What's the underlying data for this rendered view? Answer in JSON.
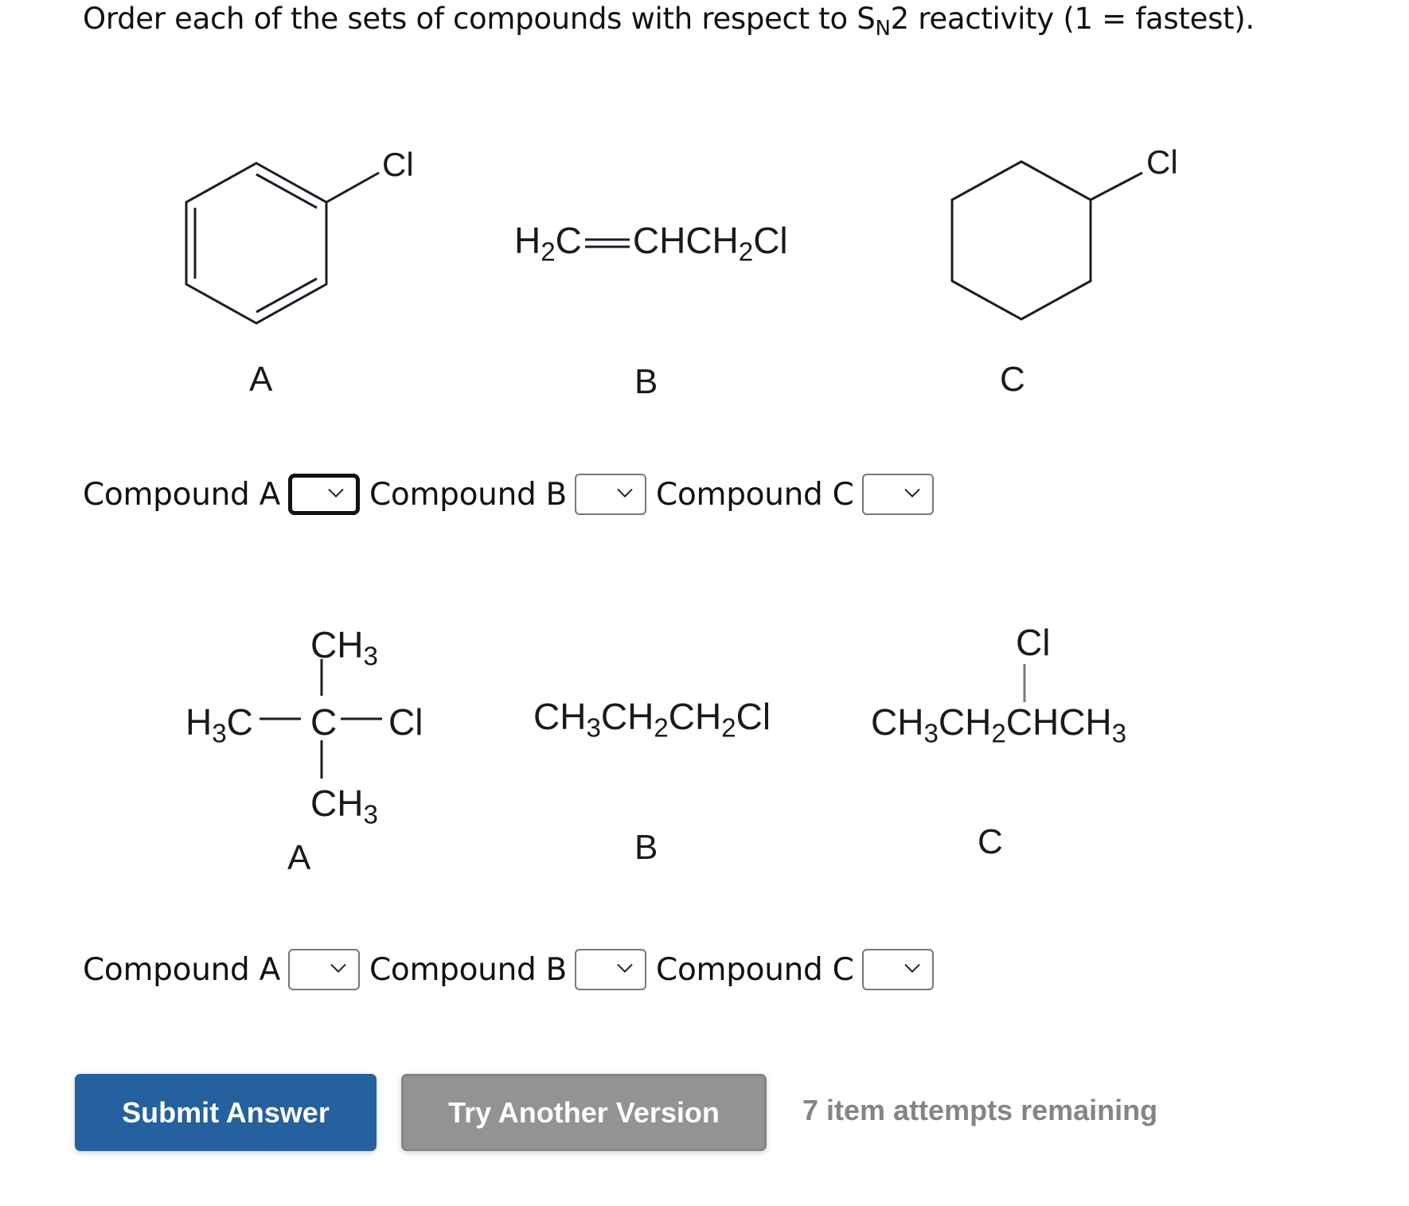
{
  "question": {
    "prefix": "Order each of the sets of compounds with respect to S",
    "subscript": "N",
    "suffix": "2 reactivity (1 = fastest)."
  },
  "set1": {
    "compounds": {
      "A": {
        "label": "A",
        "substituent": "Cl",
        "name": "chlorobenzene"
      },
      "B": {
        "label": "B",
        "formula_parts": [
          "H",
          "2",
          "C",
          "CHCH",
          "2",
          "Cl"
        ],
        "name": "allyl chloride"
      },
      "C": {
        "label": "C",
        "substituent": "Cl",
        "name": "chlorocyclohexane"
      }
    },
    "selects": [
      {
        "label": "Compound A",
        "value": "",
        "focused": true
      },
      {
        "label": "Compound B",
        "value": "",
        "focused": false
      },
      {
        "label": "Compound C",
        "value": "",
        "focused": false
      }
    ]
  },
  "set2": {
    "compounds": {
      "A": {
        "label": "A",
        "top": "CH",
        "top_sub": "3",
        "left": "H",
        "left_sub": "3",
        "left_c": "C",
        "center": "C",
        "right": "Cl",
        "bottom": "CH",
        "bottom_sub": "3"
      },
      "B": {
        "label": "B",
        "p1": "CH",
        "s1": "3",
        "p2": "CH",
        "s2": "2",
        "p3": "CH",
        "s3": "2",
        "p4": "Cl"
      },
      "C": {
        "label": "C",
        "top": "Cl",
        "p1": "CH",
        "s1": "3",
        "p2": "CH",
        "s2": "2",
        "p3": "CHCH",
        "s3": "3"
      }
    },
    "selects": [
      {
        "label": "Compound A",
        "value": ""
      },
      {
        "label": "Compound B",
        "value": ""
      },
      {
        "label": "Compound C",
        "value": ""
      }
    ]
  },
  "actions": {
    "submit_label": "Submit Answer",
    "try_another_label": "Try Another Version",
    "attempts_text": "7 item attempts remaining"
  },
  "colors": {
    "submit_bg": "#25609f",
    "try_bg": "#939393",
    "attempts_text": "#858585"
  }
}
